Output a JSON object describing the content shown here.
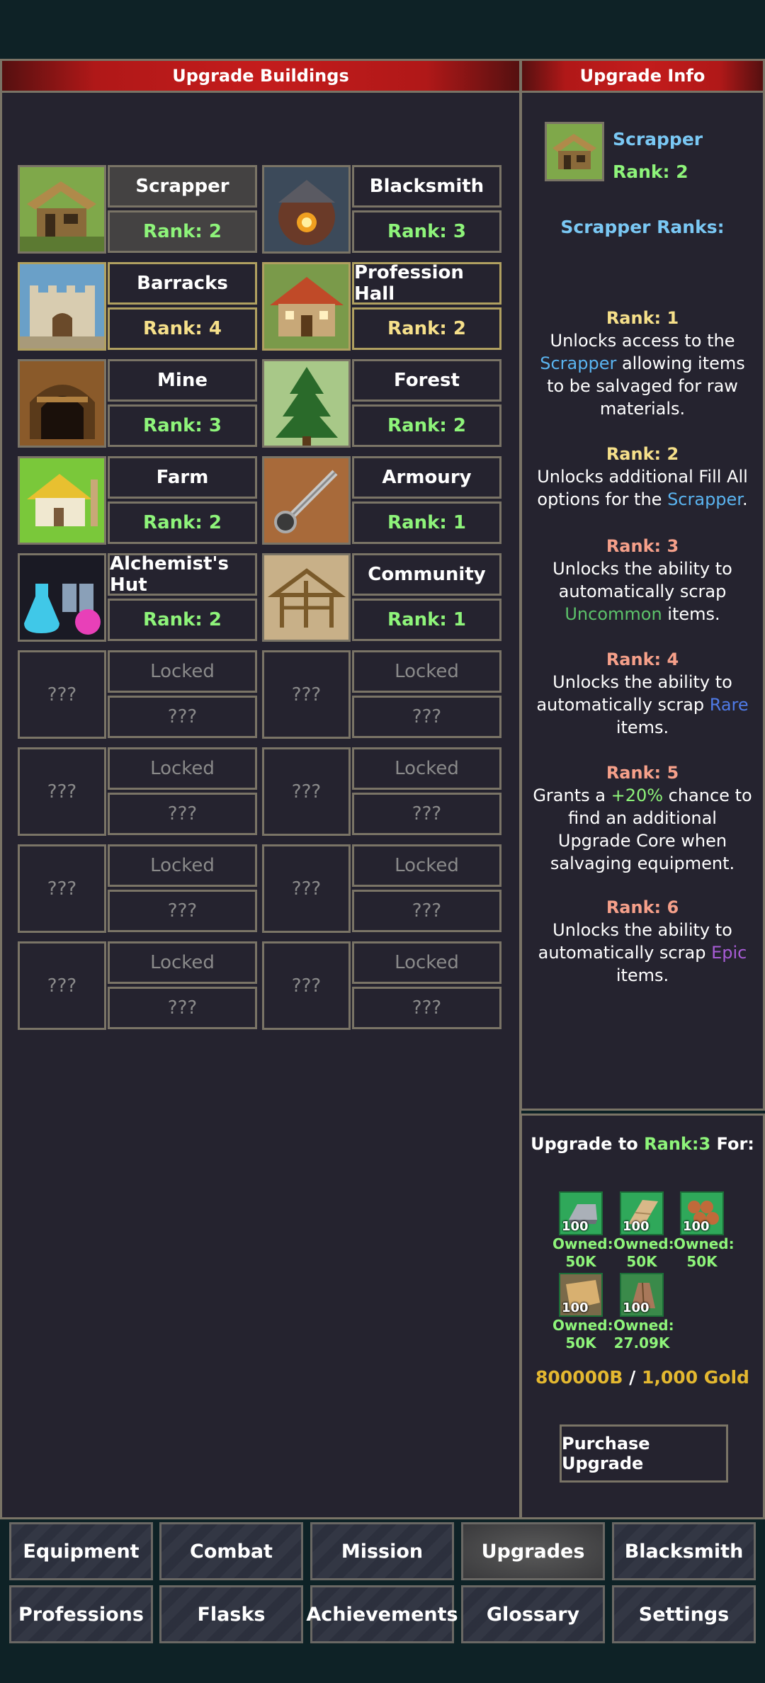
{
  "left_panel": {
    "title": "Upgrade Buildings"
  },
  "right_panel": {
    "title": "Upgrade Info"
  },
  "buildings": [
    {
      "name": "Scrapper",
      "rank": "Rank: 2",
      "icon": "scrapper-icon"
    },
    {
      "name": "Blacksmith",
      "rank": "Rank: 3",
      "icon": "blacksmith-icon"
    },
    {
      "name": "Barracks",
      "rank": "Rank: 4",
      "icon": "barracks-icon"
    },
    {
      "name": "Profession Hall",
      "rank": "Rank: 2",
      "icon": "profession-hall-icon"
    },
    {
      "name": "Mine",
      "rank": "Rank: 3",
      "icon": "mine-icon"
    },
    {
      "name": "Forest",
      "rank": "Rank: 2",
      "icon": "forest-icon"
    },
    {
      "name": "Farm",
      "rank": "Rank: 2",
      "icon": "farm-icon"
    },
    {
      "name": "Armoury",
      "rank": "Rank: 1",
      "icon": "armoury-icon"
    },
    {
      "name": "Alchemist's Hut",
      "rank": "Rank: 2",
      "icon": "alchemist-hut-icon"
    },
    {
      "name": "Community",
      "rank": "Rank: 1",
      "icon": "community-icon"
    }
  ],
  "locked": {
    "image": "???",
    "name": "Locked",
    "rank": "???"
  },
  "info": {
    "name": "Scrapper",
    "rank": "Rank: 2",
    "ranks_title": "Scrapper Ranks:",
    "ranks": [
      {
        "label": "Rank: 1",
        "parts": [
          "Unlocks access to the ",
          "Scrapper",
          " allowing items to be salvaged for raw materials."
        ]
      },
      {
        "label": "Rank: 2",
        "parts": [
          "Unlocks additional Fill All options for the ",
          "Scrapper",
          "."
        ]
      },
      {
        "label": "Rank: 3",
        "parts": [
          "Unlocks the ability to automatically scrap ",
          "Uncommon",
          " items."
        ]
      },
      {
        "label": "Rank: 4",
        "parts": [
          "Unlocks the ability to automatically scrap ",
          "Rare",
          " items."
        ]
      },
      {
        "label": "Rank: 5",
        "parts": [
          "Grants a ",
          "+20%",
          " chance to find an additional Upgrade Core when salvaging equipment."
        ]
      },
      {
        "label": "Rank: 6",
        "parts": [
          "Unlocks the ability to automatically scrap ",
          "Epic",
          " items."
        ]
      }
    ]
  },
  "cost": {
    "prefix": "Upgrade to ",
    "target": "Rank:3",
    "suffix": " For:",
    "materials": [
      {
        "qty": "100",
        "owned_label": "Owned:",
        "owned": "50K",
        "icon": "iron-ingot-icon"
      },
      {
        "qty": "100",
        "owned_label": "Owned:",
        "owned": "50K",
        "icon": "plank-icon"
      },
      {
        "qty": "100",
        "owned_label": "Owned:",
        "owned": "50K",
        "icon": "logs-icon"
      },
      {
        "qty": "100",
        "owned_label": "Owned:",
        "owned": "50K",
        "icon": "hide-icon"
      },
      {
        "qty": "100",
        "owned_label": "Owned:",
        "owned": "27.09K",
        "icon": "wood-bundle-icon"
      }
    ],
    "gold_owned": "800000B",
    "gold_sep": " / ",
    "gold_cost": "1,000 Gold",
    "purchase_label": "Purchase Upgrade"
  },
  "nav": [
    [
      "Equipment",
      "Combat",
      "Mission",
      "Upgrades",
      "Blacksmith"
    ],
    [
      "Professions",
      "Flasks",
      "Achievements",
      "Glossary",
      "Settings"
    ]
  ],
  "active_tab": "Upgrades"
}
